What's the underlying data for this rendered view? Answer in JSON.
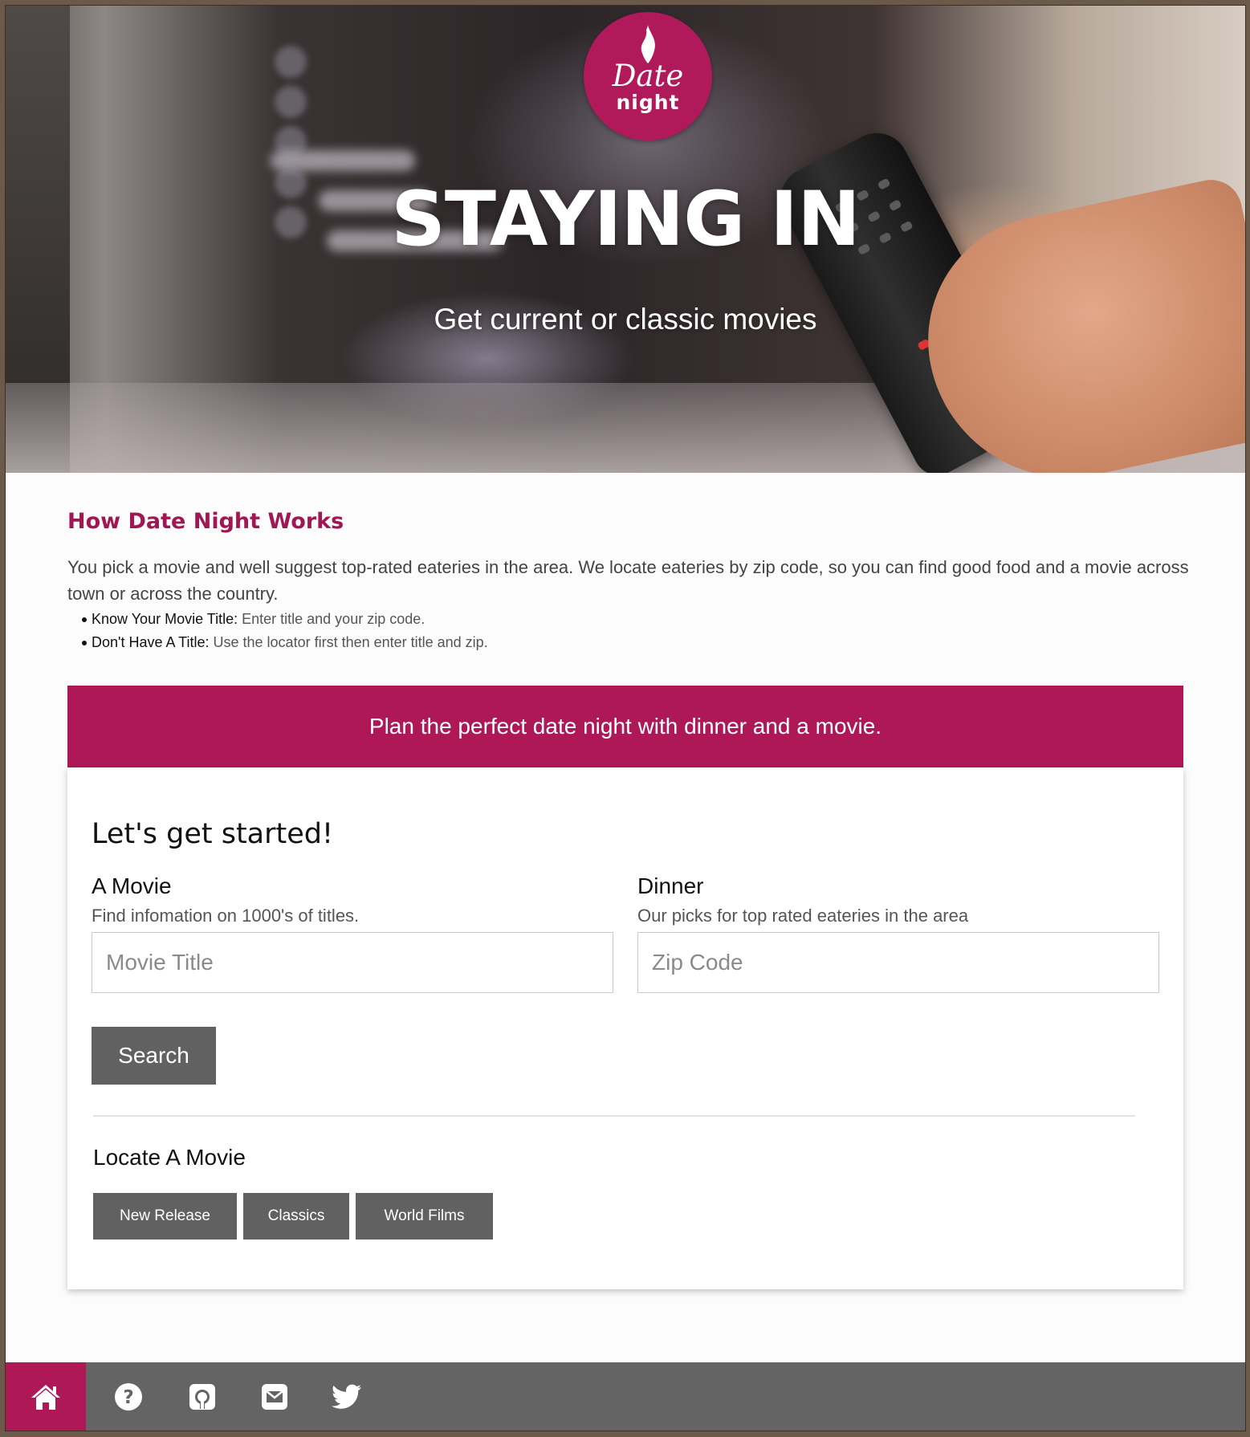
{
  "logo": {
    "line1": "Date",
    "line2": "night"
  },
  "hero": {
    "title": "STAYING IN",
    "subtitle": "Get current or classic movies"
  },
  "how": {
    "title": "How Date Night Works",
    "description": "You pick a movie and well suggest top-rated eateries in the area. We locate eateries by zip code, so you can find good food and a movie across town or across the country.",
    "items": [
      {
        "key": "Know Your Movie Title:",
        "text": " Enter title and your zip code."
      },
      {
        "key": "Don't Have A Title:",
        "text": " Use the locator first then enter title and zip."
      }
    ]
  },
  "banner": {
    "text": "Plan the perfect date night with dinner and a movie."
  },
  "form": {
    "heading": "Let's get started!",
    "movie": {
      "label": "A Movie",
      "description": "Find infomation on 1000's of titles.",
      "placeholder": "Movie Title",
      "value": ""
    },
    "dinner": {
      "label": "Dinner",
      "description": "Our picks for top rated eateries in the area",
      "placeholder": "Zip Code",
      "value": ""
    },
    "search_label": "Search"
  },
  "locate": {
    "heading": "Locate A Movie",
    "buttons": [
      "New Release",
      "Classics",
      "World Films"
    ]
  },
  "footer": {
    "items": [
      {
        "icon": "home-icon",
        "active": true
      },
      {
        "icon": "question-circle-icon",
        "active": false
      },
      {
        "icon": "github-icon",
        "active": false
      },
      {
        "icon": "envelope-icon",
        "active": false
      },
      {
        "icon": "twitter-icon",
        "active": false
      }
    ]
  },
  "colors": {
    "brand": "#ae1857",
    "button": "#616161",
    "footer": "#646464"
  }
}
